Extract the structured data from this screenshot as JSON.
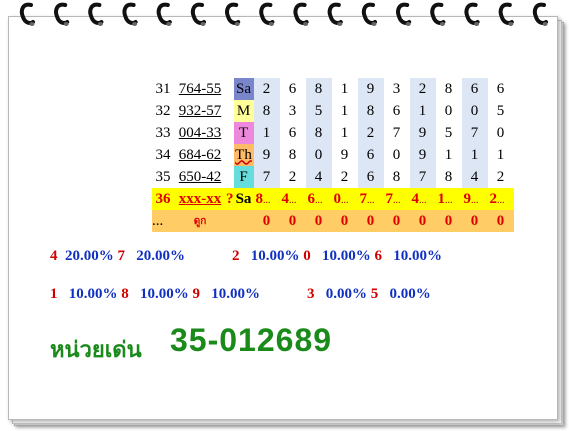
{
  "rows": [
    {
      "num": "31",
      "pair": "764-55",
      "day": "Sa",
      "digits": [
        "2",
        "6",
        "8",
        "1",
        "9",
        "3",
        "2",
        "8",
        "6",
        "6"
      ]
    },
    {
      "num": "32",
      "pair": "932-57",
      "day": "M",
      "digits": [
        "8",
        "3",
        "5",
        "1",
        "8",
        "6",
        "1",
        "0",
        "0",
        "5"
      ]
    },
    {
      "num": "33",
      "pair": "004-33",
      "day": "T",
      "digits": [
        "1",
        "6",
        "8",
        "1",
        "2",
        "7",
        "9",
        "5",
        "7",
        "0"
      ]
    },
    {
      "num": "34",
      "pair": "684-62",
      "day": "Th",
      "digits": [
        "9",
        "8",
        "0",
        "9",
        "6",
        "0",
        "9",
        "1",
        "1",
        "1"
      ]
    },
    {
      "num": "35",
      "pair": "650-42",
      "day": "F",
      "digits": [
        "7",
        "2",
        "4",
        "2",
        "6",
        "8",
        "7",
        "8",
        "4",
        "2"
      ]
    }
  ],
  "pred": {
    "num": "36",
    "pair": "xxx-xx",
    "q": "?",
    "day": "Sa",
    "digits": [
      "8",
      "4",
      "6",
      "0",
      "7",
      "7",
      "4",
      "1",
      "9",
      "2"
    ],
    "dots": "..."
  },
  "summary": {
    "lead": "...",
    "look": "ดูก",
    "zeros": [
      "0",
      "0",
      "0",
      "0",
      "0",
      "0",
      "0",
      "0",
      "0",
      "0"
    ]
  },
  "stats_line1": [
    {
      "digit": "4",
      "pct": "20.00%"
    },
    {
      "digit": "7",
      "pct": "20.00%"
    },
    {
      "digit": "2",
      "pct": "10.00%"
    },
    {
      "digit": "0",
      "pct": "10.00%"
    },
    {
      "digit": "6",
      "pct": "10.00%"
    }
  ],
  "stats_line2": [
    {
      "digit": "1",
      "pct": "10.00%"
    },
    {
      "digit": "8",
      "pct": "10.00%"
    },
    {
      "digit": "9",
      "pct": "10.00%"
    },
    {
      "digit": "3",
      "pct": "0.00%"
    },
    {
      "digit": "5",
      "pct": "0.00%"
    }
  ],
  "footer": {
    "label": "หน่วยเด่น",
    "number": "35-012689"
  },
  "colors": {
    "green": "#1a8a1a",
    "red": "#d00000",
    "blue": "#1030c0",
    "cell": "#dde6f5",
    "pred": "#ffff00",
    "sum": "#ffcc66"
  }
}
